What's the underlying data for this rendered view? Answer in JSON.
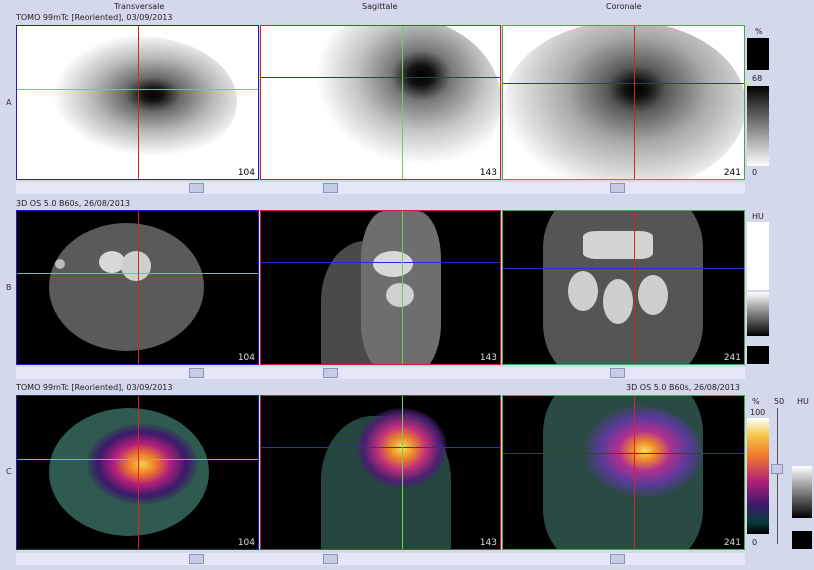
{
  "columns": {
    "transversal": "Transversale",
    "sagittal": "Sagittale",
    "coronal": "Coronale"
  },
  "rows": [
    {
      "label": "A",
      "series": "TOMO 99mTc [Reoriented], 03/09/2013",
      "slices": [
        "104",
        "143",
        "241"
      ]
    },
    {
      "label": "B",
      "series": "3D OS 5.0 B60s, 26/08/2013",
      "slices": [
        "104",
        "143",
        "241"
      ]
    },
    {
      "label": "C",
      "series": "TOMO 99mTc [Reoriented], 03/09/2013",
      "series_right": "3D OS 5.0 B60s, 26/08/2013",
      "slices": [
        "104",
        "143",
        "241"
      ]
    }
  ],
  "scales": {
    "a": {
      "unit": "%",
      "top": "68",
      "bottom": "0"
    },
    "b": {
      "unit": "HU"
    },
    "c_pet": {
      "unit": "%",
      "top": "100",
      "bottom": "0"
    },
    "c_fusion": {
      "value": "50"
    },
    "c_ct": {
      "unit": "HU"
    }
  },
  "colors": {
    "crosshair_green": "#6cd64a",
    "crosshair_red": "#e02020",
    "crosshair_blue": "#2a2ad8",
    "frame_blue": "#2020c0",
    "frame_red": "#cc2222",
    "frame_green": "#44aa44"
  }
}
